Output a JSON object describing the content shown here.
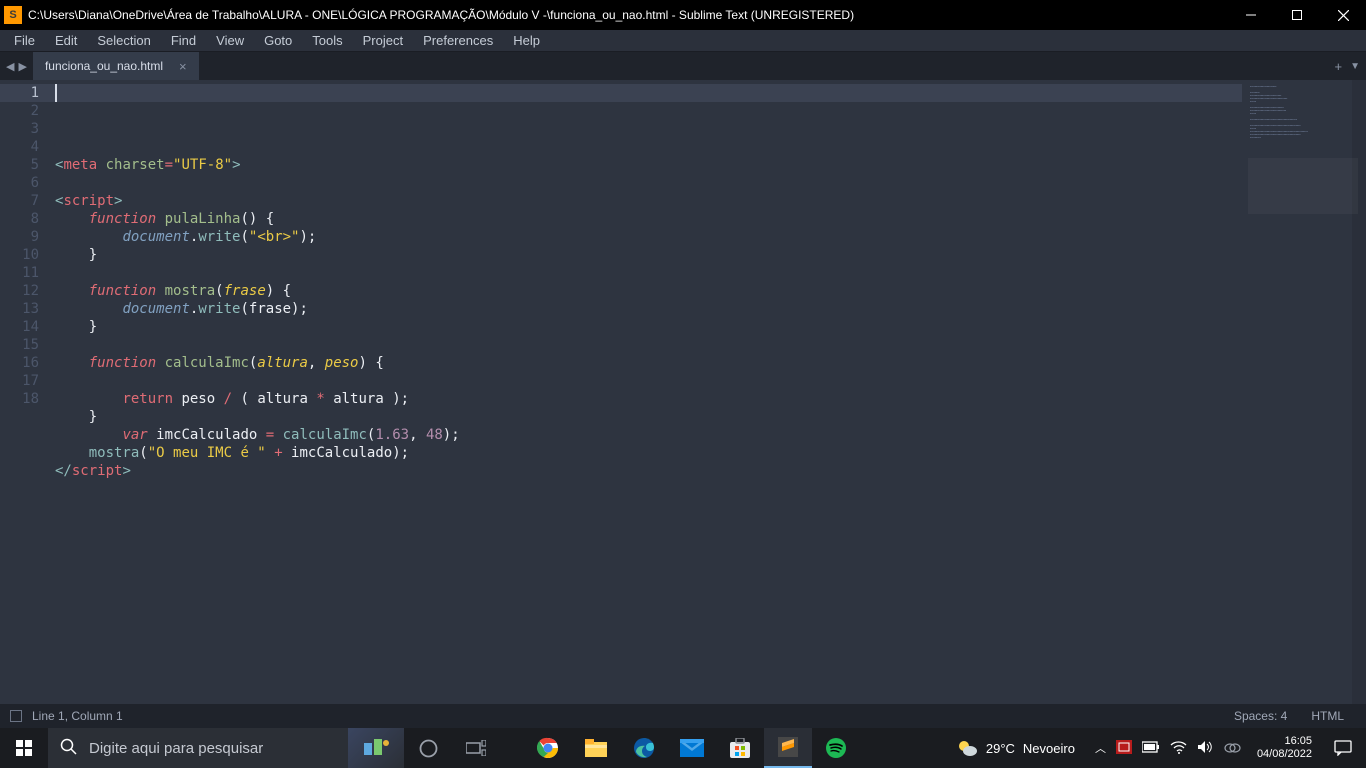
{
  "titlebar": {
    "app_icon_letter": "S",
    "title": "C:\\Users\\Diana\\OneDrive\\Área de Trabalho\\ALURA - ONE\\LÓGICA PROGRAMAÇÃO\\Módulo V -\\funciona_ou_nao.html - Sublime Text (UNREGISTERED)"
  },
  "menubar": [
    "File",
    "Edit",
    "Selection",
    "Find",
    "View",
    "Goto",
    "Tools",
    "Project",
    "Preferences",
    "Help"
  ],
  "tab": {
    "name": "funciona_ou_nao.html"
  },
  "gutter_lines": 18,
  "status": {
    "position": "Line 1, Column 1",
    "spaces": "Spaces: 4",
    "syntax": "HTML"
  },
  "taskbar": {
    "search_placeholder": "Digite aqui para pesquisar",
    "weather_temp": "29°C",
    "weather_desc": "Nevoeiro",
    "time": "16:05",
    "date": "04/08/2022"
  },
  "code_tokens": [
    [
      [
        "tok-punct",
        "<"
      ],
      [
        "tok-tag",
        "meta"
      ],
      [
        "tok-plain",
        " "
      ],
      [
        "tok-funcdef",
        "charset"
      ],
      [
        "tok-op",
        "="
      ],
      [
        "tok-str2",
        "\"UTF-8\""
      ],
      [
        "tok-punct",
        ">"
      ]
    ],
    [],
    [
      [
        "tok-punct",
        "<"
      ],
      [
        "tok-tag",
        "script"
      ],
      [
        "tok-punct",
        ">"
      ]
    ],
    [
      [
        "tok-plain",
        "    "
      ],
      [
        "tok-kw",
        "function"
      ],
      [
        "tok-plain",
        " "
      ],
      [
        "tok-funcdef",
        "pulaLinha"
      ],
      [
        "tok-plain",
        "() {"
      ]
    ],
    [
      [
        "tok-plain",
        "        "
      ],
      [
        "tok-var",
        "document"
      ],
      [
        "tok-plain",
        "."
      ],
      [
        "tok-func",
        "write"
      ],
      [
        "tok-plain",
        "("
      ],
      [
        "tok-str2",
        "\"<br>\""
      ],
      [
        "tok-plain",
        ");"
      ]
    ],
    [
      [
        "tok-plain",
        "    }"
      ]
    ],
    [],
    [
      [
        "tok-plain",
        "    "
      ],
      [
        "tok-kw",
        "function"
      ],
      [
        "tok-plain",
        " "
      ],
      [
        "tok-funcdef",
        "mostra"
      ],
      [
        "tok-plain",
        "("
      ],
      [
        "tok-param",
        "frase"
      ],
      [
        "tok-plain",
        ") {"
      ]
    ],
    [
      [
        "tok-plain",
        "        "
      ],
      [
        "tok-var",
        "document"
      ],
      [
        "tok-plain",
        "."
      ],
      [
        "tok-func",
        "write"
      ],
      [
        "tok-plain",
        "("
      ],
      [
        "tok-plain",
        "frase);"
      ]
    ],
    [
      [
        "tok-plain",
        "    }"
      ]
    ],
    [],
    [
      [
        "tok-plain",
        "    "
      ],
      [
        "tok-kw",
        "function"
      ],
      [
        "tok-plain",
        " "
      ],
      [
        "tok-funcdef",
        "calculaImc"
      ],
      [
        "tok-plain",
        "("
      ],
      [
        "tok-param",
        "altura"
      ],
      [
        "tok-plain",
        ", "
      ],
      [
        "tok-param",
        "peso"
      ],
      [
        "tok-plain",
        ") {"
      ]
    ],
    [],
    [
      [
        "tok-plain",
        "        "
      ],
      [
        "tok-kw2",
        "return"
      ],
      [
        "tok-plain",
        " peso "
      ],
      [
        "tok-op",
        "/"
      ],
      [
        "tok-plain",
        " ( altura "
      ],
      [
        "tok-op",
        "*"
      ],
      [
        "tok-plain",
        " altura );"
      ]
    ],
    [
      [
        "tok-plain",
        "    }"
      ]
    ],
    [
      [
        "tok-plain",
        "        "
      ],
      [
        "tok-kw",
        "var"
      ],
      [
        "tok-plain",
        " imcCalculado "
      ],
      [
        "tok-op",
        "="
      ],
      [
        "tok-plain",
        " "
      ],
      [
        "tok-func",
        "calculaImc"
      ],
      [
        "tok-plain",
        "("
      ],
      [
        "tok-num",
        "1.63"
      ],
      [
        "tok-plain",
        ", "
      ],
      [
        "tok-num",
        "48"
      ],
      [
        "tok-plain",
        ");"
      ]
    ],
    [
      [
        "tok-plain",
        "    "
      ],
      [
        "tok-func",
        "mostra"
      ],
      [
        "tok-plain",
        "("
      ],
      [
        "tok-str2",
        "\"O meu IMC é \""
      ],
      [
        "tok-plain",
        " "
      ],
      [
        "tok-op",
        "+"
      ],
      [
        "tok-plain",
        " imcCalculado);"
      ]
    ],
    [
      [
        "tok-punct",
        "</"
      ],
      [
        "tok-tag",
        "script"
      ],
      [
        "tok-punct",
        ">"
      ]
    ]
  ]
}
